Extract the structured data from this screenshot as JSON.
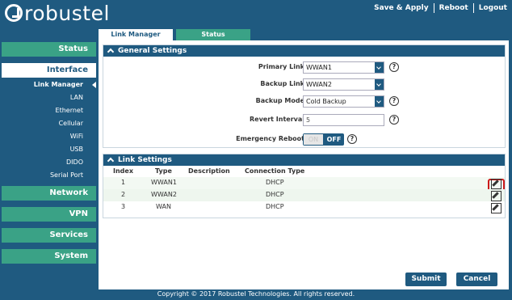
{
  "header": {
    "logo_text": "robustel",
    "save_apply": "Save & Apply",
    "reboot": "Reboot",
    "logout": "Logout"
  },
  "sidebar": {
    "status": "Status",
    "interface": "Interface",
    "interface_items": [
      "Link Manager",
      "LAN",
      "Ethernet",
      "Cellular",
      "WiFi",
      "USB",
      "DIDO",
      "Serial Port"
    ],
    "network": "Network",
    "vpn": "VPN",
    "services": "Services",
    "system": "System"
  },
  "tabs": [
    "Link Manager",
    "Status"
  ],
  "general": {
    "title": "General Settings",
    "primary_link": {
      "label": "Primary Link",
      "value": "WWAN1"
    },
    "backup_link": {
      "label": "Backup Link",
      "value": "WWAN2"
    },
    "backup_mode": {
      "label": "Backup Mode",
      "value": "Cold Backup"
    },
    "revert_interval": {
      "label": "Revert Interval",
      "value": "5"
    },
    "emergency_reboot": {
      "label": "Emergency Reboot",
      "on": "ON",
      "off": "OFF"
    },
    "help": "?"
  },
  "link_settings": {
    "title": "Link Settings",
    "columns": [
      "Index",
      "Type",
      "Description",
      "Connection Type"
    ],
    "rows": [
      {
        "index": "1",
        "type": "WWAN1",
        "description": "",
        "connection": "DHCP"
      },
      {
        "index": "2",
        "type": "WWAN2",
        "description": "",
        "connection": "DHCP"
      },
      {
        "index": "3",
        "type": "WAN",
        "description": "",
        "connection": "DHCP"
      }
    ]
  },
  "buttons": {
    "submit": "Submit",
    "cancel": "Cancel"
  },
  "footer": "Copyright © 2017 Robustel Technologies. All rights reserved.",
  "colors": {
    "navy": "#1f5a80",
    "green": "#3aa286",
    "highlight": "#cc1a1a"
  }
}
